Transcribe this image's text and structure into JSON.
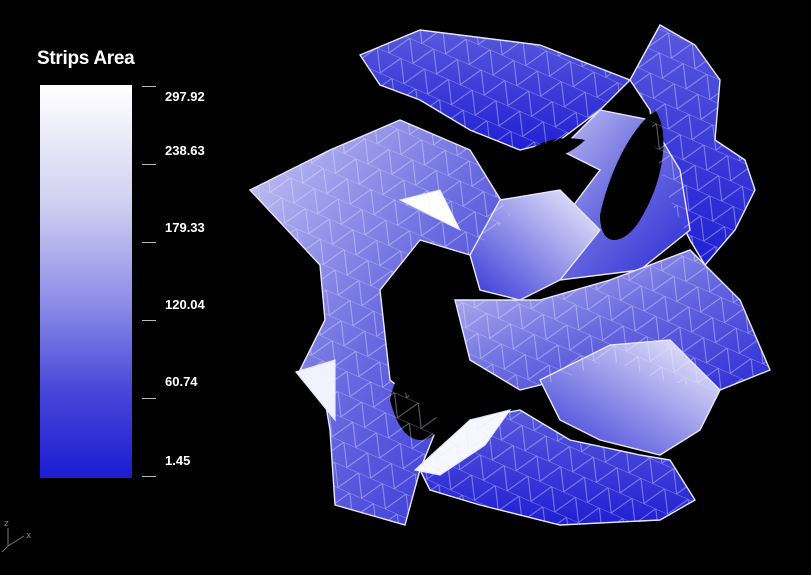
{
  "legend": {
    "title": "Strips Area",
    "ticks": [
      "297.92",
      "238.63",
      "179.33",
      "120.04",
      "60.74",
      "1.45"
    ]
  },
  "axis_indicator": {
    "z_label": "z",
    "x_label": "x"
  },
  "colors": {
    "background": "#000000",
    "max": "#ffffff",
    "min": "#1c1cd2",
    "edge": "#e6e6ff"
  },
  "icons": [
    "axis-gizmo-icon"
  ]
}
